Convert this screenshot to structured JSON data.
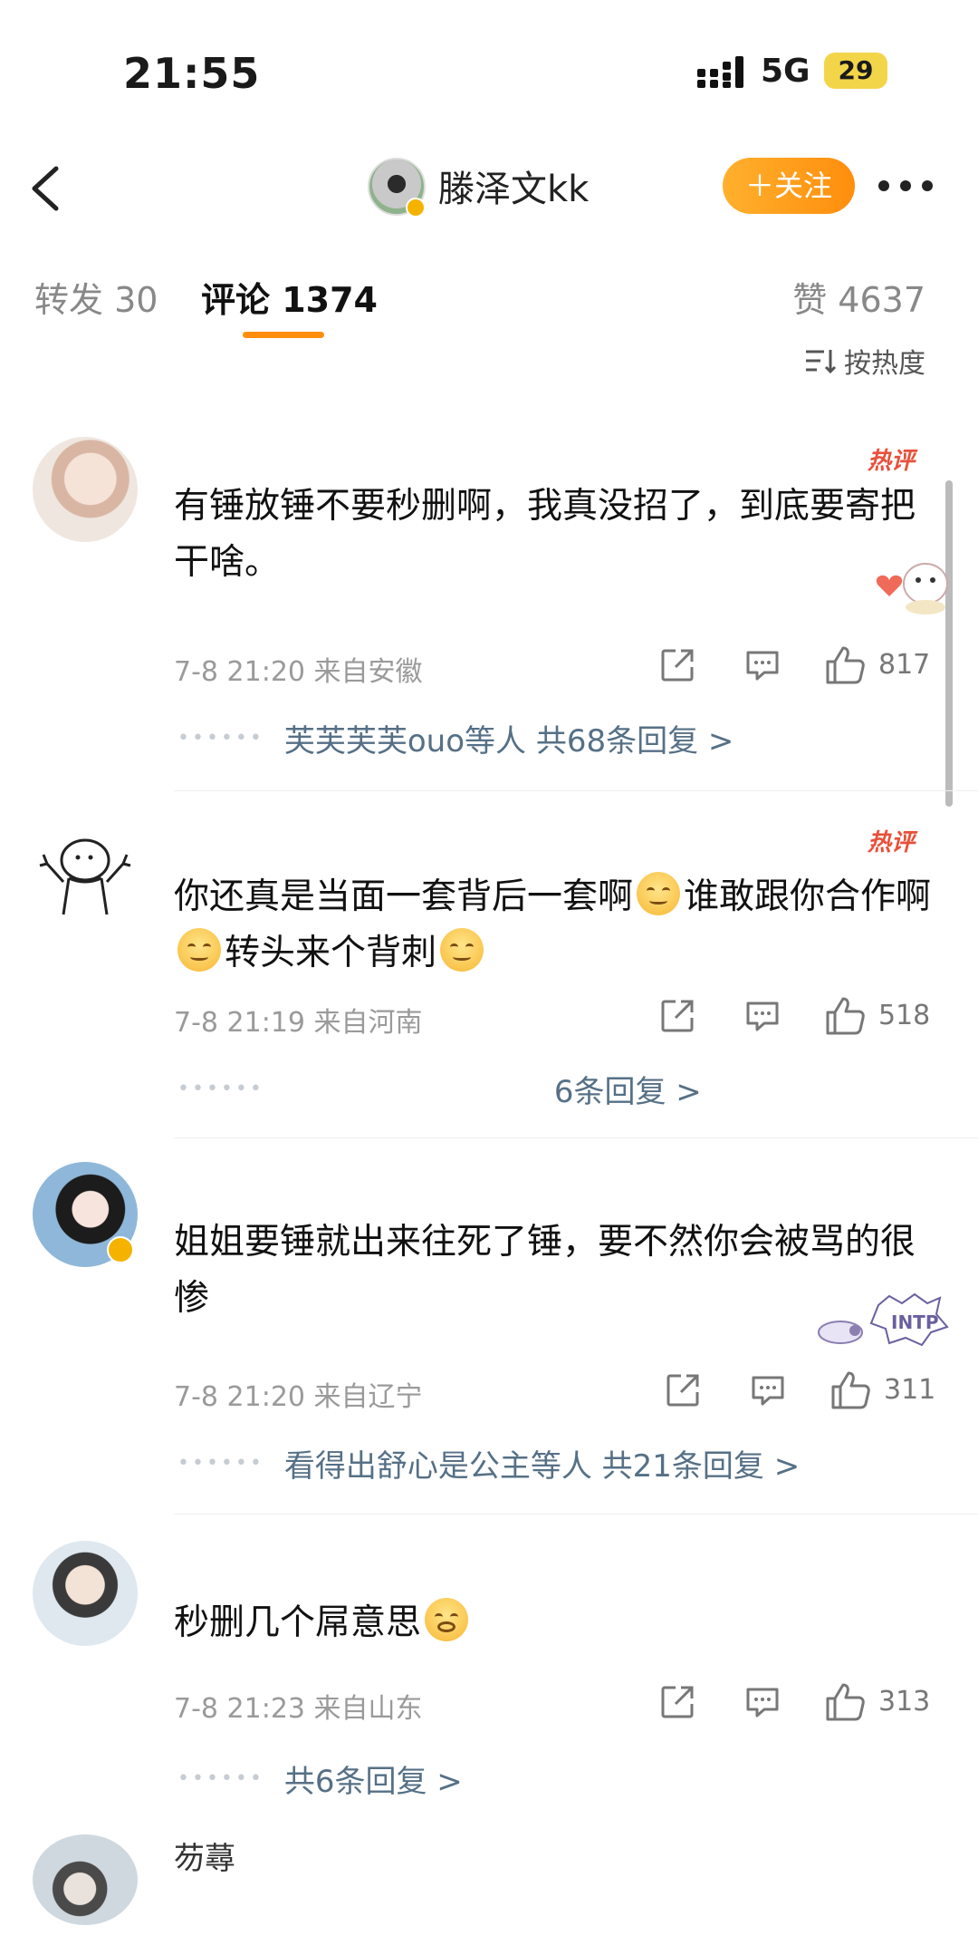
{
  "status_bar": {
    "time": "21:55",
    "network": "5G",
    "battery": "29"
  },
  "header": {
    "user_name": "滕泽文kk",
    "follow_label": "＋关注"
  },
  "tabs": {
    "repost": "转发 30",
    "comments": "评论 1374",
    "likes": "赞 4637"
  },
  "sort_label": "按热度",
  "colors": {
    "accent": "#ff8e0c",
    "reply_link": "#567086",
    "hot_badge": "#e8503a",
    "meta": "#9a9a9a"
  },
  "comments": [
    {
      "hot_badge": "热评",
      "text": "有锤放锤不要秒删啊，我真没招了，到底要寄把干啥。",
      "meta": "7-8 21:20  来自安徽",
      "likes": "817",
      "replies": "芙芙芙芙ouo等人  共68条回复 >"
    },
    {
      "hot_badge": "热评",
      "text_parts": [
        "你还真是当面一套背后一套啊",
        "谁敢跟你合作啊",
        "转头来个背刺"
      ],
      "meta": "7-8 21:19  来自河南",
      "likes": "518",
      "replies": "6条回复 >"
    },
    {
      "text": "姐姐要锤就出来往死了锤，要不然你会被骂的很惨",
      "meta": "7-8 21:20  来自辽宁",
      "likes": "311",
      "replies": "看得出舒心是公主等人  共21条回复 >",
      "sticker_text": "INTP"
    },
    {
      "text": "秒删几个屌意思",
      "meta": "7-8 21:23  来自山东",
      "likes": "313",
      "replies": "共6条回复 >"
    },
    {
      "user_name": "芴蕁"
    }
  ]
}
